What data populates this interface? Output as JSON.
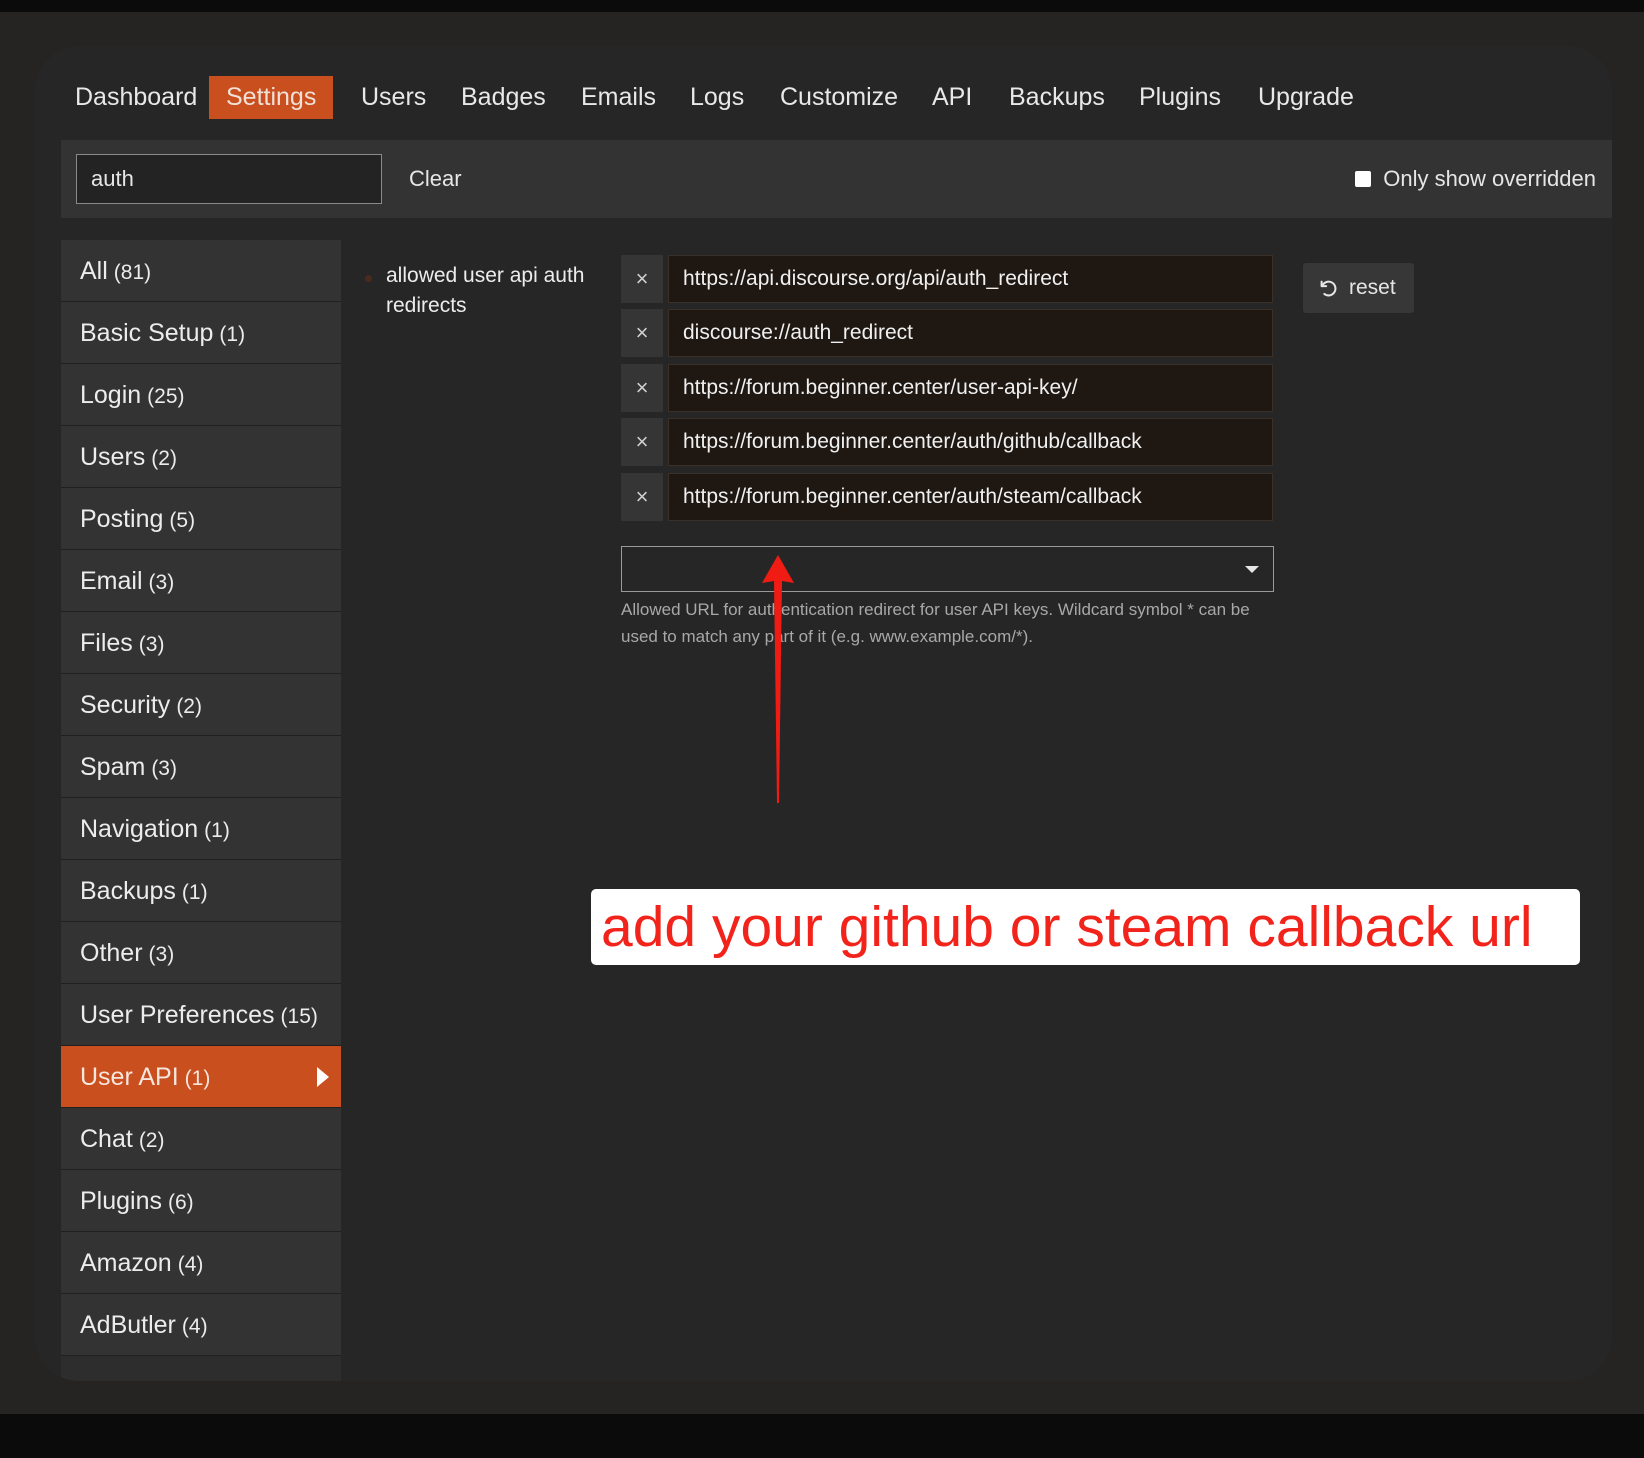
{
  "nav": {
    "items": [
      {
        "label": "Dashboard"
      },
      {
        "label": "Settings"
      },
      {
        "label": "Users"
      },
      {
        "label": "Badges"
      },
      {
        "label": "Emails"
      },
      {
        "label": "Logs"
      },
      {
        "label": "Customize"
      },
      {
        "label": "API"
      },
      {
        "label": "Backups"
      },
      {
        "label": "Plugins"
      },
      {
        "label": "Upgrade"
      }
    ],
    "active": "Settings"
  },
  "filter": {
    "search_value": "auth",
    "clear_label": "Clear",
    "only_overridden_label": "Only show overridden",
    "only_overridden_checked": false
  },
  "sidebar": {
    "items": [
      {
        "label": "All",
        "count": "(81)"
      },
      {
        "label": "Basic Setup",
        "count": "(1)"
      },
      {
        "label": "Login",
        "count": "(25)"
      },
      {
        "label": "Users",
        "count": "(2)"
      },
      {
        "label": "Posting",
        "count": "(5)"
      },
      {
        "label": "Email",
        "count": "(3)"
      },
      {
        "label": "Files",
        "count": "(3)"
      },
      {
        "label": "Security",
        "count": "(2)"
      },
      {
        "label": "Spam",
        "count": "(3)"
      },
      {
        "label": "Navigation",
        "count": "(1)"
      },
      {
        "label": "Backups",
        "count": "(1)"
      },
      {
        "label": "Other",
        "count": "(3)"
      },
      {
        "label": "User Preferences",
        "count": "(15)"
      },
      {
        "label": "User API",
        "count": "(1)"
      },
      {
        "label": "Chat",
        "count": "(2)"
      },
      {
        "label": "Plugins",
        "count": "(6)"
      },
      {
        "label": "Amazon",
        "count": "(4)"
      },
      {
        "label": "AdButler",
        "count": "(4)"
      }
    ],
    "active": "User API"
  },
  "setting": {
    "label": "allowed user api auth redirects",
    "values": [
      "https://api.discourse.org/api/auth_redirect",
      "discourse://auth_redirect",
      "https://forum.beginner.center/user-api-key/",
      "https://forum.beginner.center/auth/github/callback",
      "https://forum.beginner.center/auth/steam/callback"
    ],
    "remove_glyph": "×",
    "description": "Allowed URL for authentication redirect for user API keys. Wildcard symbol * can be used to match any part of it (e.g. www.example.com/*).",
    "reset_label": "reset"
  },
  "annotation": {
    "text": "add your github or steam callback url",
    "color": "#f2231a"
  },
  "colors": {
    "accent": "#c94f1e",
    "background": "#262626"
  },
  "icons": {
    "remove": "close-icon",
    "reset": "undo-icon",
    "dropdown": "caret-down-icon",
    "active_category": "caret-right-icon"
  }
}
